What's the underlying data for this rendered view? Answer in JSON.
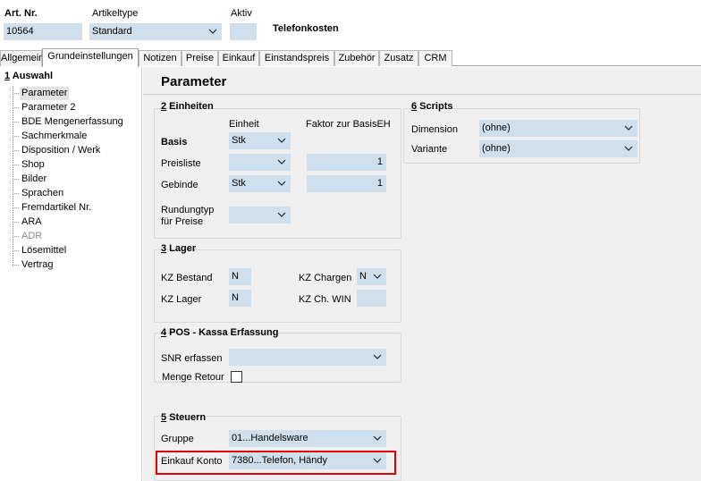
{
  "header": {
    "art_nr_label": "Art. Nr.",
    "art_nr_value": "10564",
    "artikeltype_label": "Artikeltype",
    "artikeltype_value": "Standard",
    "aktiv_label": "Aktiv",
    "aktiv_value": "",
    "title": "Telefonkosten"
  },
  "tabs": [
    {
      "label": "Allgemein"
    },
    {
      "label": "Grundeinstellungen"
    },
    {
      "label": "Notizen"
    },
    {
      "label": "Preise"
    },
    {
      "label": "Einkauf"
    },
    {
      "label": "Einstandspreis"
    },
    {
      "label": "Zubehör"
    },
    {
      "label": "Zusatz"
    },
    {
      "label": "CRM"
    }
  ],
  "nav": {
    "heading_num": "1",
    "heading_text": " Auswahl",
    "items": [
      {
        "label": "Parameter"
      },
      {
        "label": "Parameter 2"
      },
      {
        "label": "BDE Mengenerfassung"
      },
      {
        "label": "Sachmerkmale"
      },
      {
        "label": "Disposition / Werk"
      },
      {
        "label": "Shop"
      },
      {
        "label": "Bilder"
      },
      {
        "label": "Sprachen"
      },
      {
        "label": "Fremdartikel Nr."
      },
      {
        "label": "ARA"
      },
      {
        "label": "ADR"
      },
      {
        "label": "Lösemittel"
      },
      {
        "label": "Vertrag"
      }
    ]
  },
  "panel": {
    "title": "Parameter",
    "einheiten": {
      "num": "2",
      "title": " Einheiten",
      "col_einheit": "Einheit",
      "col_faktor": "Faktor zur BasisEH",
      "basis_label": "Basis",
      "basis_value": "Stk",
      "preisliste_label": "Preisliste",
      "preisliste_value": "",
      "preisliste_faktor": "1",
      "gebinde_label": "Gebinde",
      "gebinde_value": "Stk",
      "gebinde_faktor": "1",
      "rundung_label_1": "Rundungtyp",
      "rundung_label_2": "für Preise",
      "rundung_value": ""
    },
    "lager": {
      "num": "3",
      "title": " Lager",
      "kz_bestand_label": "KZ Bestand",
      "kz_bestand_value": "N",
      "kz_chargen_label": "KZ Chargen",
      "kz_chargen_value": "N",
      "kz_lager_label": "KZ Lager",
      "kz_lager_value": "N",
      "kz_chwin_label": "KZ Ch. WIN",
      "kz_chwin_value": ""
    },
    "pos": {
      "num": "4",
      "title": " POS - Kassa Erfassung",
      "snr_label": "SNR erfassen",
      "snr_value": "",
      "menge_retour_label": "Menge Retour"
    },
    "steuern": {
      "num": "5",
      "title": " Steuern",
      "gruppe_label": "Gruppe",
      "gruppe_value": "01...Handelsware",
      "einkauf_label": "Einkauf Konto",
      "einkauf_value": "7380...Telefon, Händy"
    },
    "scripts": {
      "num": "6",
      "title": " Scripts",
      "dimension_label": "Dimension",
      "dimension_value": "(ohne)",
      "variante_label": "Variante",
      "variante_value": "(ohne)"
    }
  },
  "colors": {
    "field_bg": "#cfe0ec",
    "panel_bg": "#f0f0f0",
    "highlight_border": "#e00000"
  }
}
